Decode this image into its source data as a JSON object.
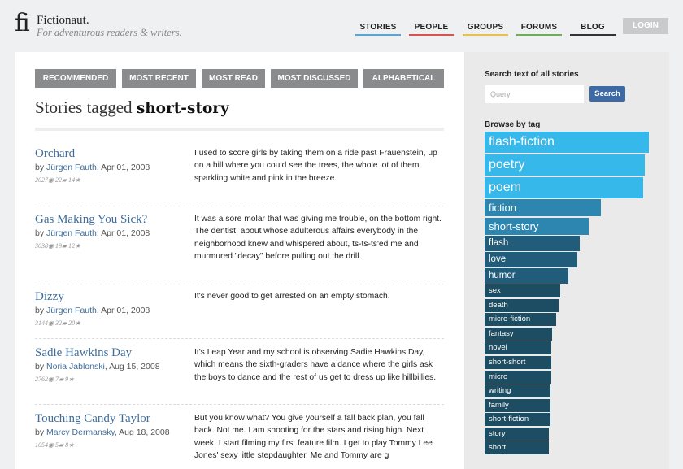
{
  "site": {
    "logo_mark": "fi",
    "name": "Fictionaut.",
    "tagline": "For adventurous readers & writers."
  },
  "nav": [
    {
      "label": "STORIES",
      "color": "#5aa4d6"
    },
    {
      "label": "PEOPLE",
      "color": "#d9534f"
    },
    {
      "label": "GROUPS",
      "color": "#e7c04d"
    },
    {
      "label": "FORUMS",
      "color": "#6fae52"
    },
    {
      "label": "BLOG",
      "color": "#333333"
    }
  ],
  "login_label": "LOGIN",
  "tabs": [
    "RECOMMENDED",
    "MOST RECENT",
    "MOST READ",
    "MOST DISCUSSED",
    "ALPHABETICAL"
  ],
  "page_title": {
    "prefix": "Stories tagged ",
    "tag": "short-story"
  },
  "stories": [
    {
      "title": "Orchard",
      "by": "by ",
      "author": "Jürgen Fauth",
      "date": ", Apr 01, 2008",
      "reads": "2027",
      "comments": "22",
      "favs": "14",
      "excerpt": "I used to score girls by taking them on a ride past Frauenstein, up on a hill where you could see the trees, the whole lot of them sparkling white and pink in the breeze."
    },
    {
      "title": "Gas Making You Sick?",
      "by": "by ",
      "author": "Jürgen Fauth",
      "date": ", Apr 01, 2008",
      "reads": "3038",
      "comments": "19",
      "favs": "12",
      "excerpt": "It was a sore molar that was giving me trouble, on the bottom right. The dentist, about whose adulterous affairs everybody in the neighborhood knew and whispered about, ts-ts-ts'ed me and murmured \"decay\" before pulling out the drill."
    },
    {
      "title": "Dizzy",
      "by": "by ",
      "author": "Jürgen Fauth",
      "date": ", Apr 01, 2008",
      "reads": "3144",
      "comments": "32",
      "favs": "20",
      "excerpt": "It's never good to get arrested on an empty stomach."
    },
    {
      "title": "Sadie Hawkins Day",
      "by": "by ",
      "author": "Noria Jablonski",
      "date": ", Aug 15, 2008",
      "reads": "2762",
      "comments": "7",
      "favs": "9",
      "excerpt": "It's Leap Year and my school is observing Sadie Hawkins Day, which means the sixth-graders have a dance where the girls ask the boys to dance and the rest of us get to dress up like hillbillies."
    },
    {
      "title": "Touching Candy Taylor",
      "by": "by ",
      "author": "Marcy Dermansky",
      "date": ", Aug 18, 2008",
      "reads": "1054",
      "comments": "5",
      "favs": "8",
      "excerpt": "But you know what? You give yourself a fall back plan, you fall back. Not me. I am shooting for the stars and rising high. Next week, I start filming my first feature film. I get to play Tommy Lee Jones' sexy little stepdaughter. Me and Tommy are g"
    }
  ],
  "sidebar": {
    "search_heading": "Search text of all stories",
    "search_placeholder": "Query",
    "search_button": "Search",
    "tags_heading": "Browse by tag",
    "tags": [
      {
        "name": "flash-fiction",
        "color": "#36b8ea"
      },
      {
        "name": "poetry",
        "color": "#36b8ea"
      },
      {
        "name": "poem",
        "color": "#36b8ea"
      },
      {
        "name": "fiction",
        "color": "#2d86af"
      },
      {
        "name": "short-story",
        "color": "#2d86af"
      },
      {
        "name": "flash",
        "color": "#215d7a"
      },
      {
        "name": "love",
        "color": "#215d7a"
      },
      {
        "name": "humor",
        "color": "#215d7a"
      },
      {
        "name": "sex",
        "color": "#1d4d62"
      },
      {
        "name": "death",
        "color": "#1d4d62"
      },
      {
        "name": "micro-fiction",
        "color": "#1d4d62"
      },
      {
        "name": "fantasy",
        "color": "#1d4d62"
      },
      {
        "name": "novel",
        "color": "#1d4d62"
      },
      {
        "name": "short-short",
        "color": "#1d4d62"
      },
      {
        "name": "micro",
        "color": "#1d4d62"
      },
      {
        "name": "writing",
        "color": "#1d4d62"
      },
      {
        "name": "family",
        "color": "#1d4d62"
      },
      {
        "name": "short-fiction",
        "color": "#1d4d62"
      },
      {
        "name": "story",
        "color": "#1d4d62"
      },
      {
        "name": "short",
        "color": "#1d4d62"
      }
    ]
  }
}
